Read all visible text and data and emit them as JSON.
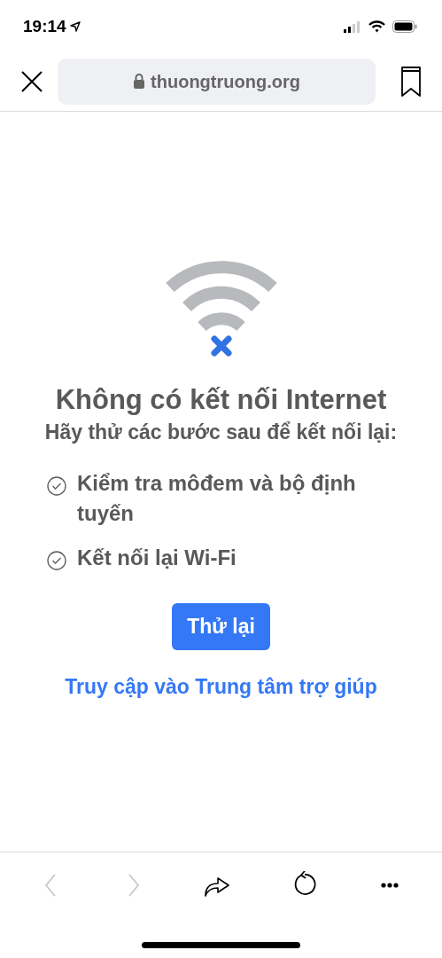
{
  "status_bar": {
    "time": "19:14"
  },
  "nav": {
    "url": "thuongtruong.org"
  },
  "error": {
    "title": "Không có kết nối Internet",
    "subtitle": "Hãy thử các bước sau để kết nối lại:",
    "steps": [
      "Kiểm tra môđem và bộ định tuyến",
      "Kết nối lại Wi-Fi"
    ],
    "button": "Thử lại",
    "link": "Truy cập vào Trung tâm trợ giúp"
  },
  "toolbar": [
    {
      "kind": "back",
      "disabled": true
    },
    {
      "kind": "forward",
      "disabled": true
    },
    {
      "kind": "share",
      "disabled": false
    },
    {
      "kind": "reload",
      "disabled": false
    },
    {
      "kind": "more",
      "disabled": false
    }
  ]
}
